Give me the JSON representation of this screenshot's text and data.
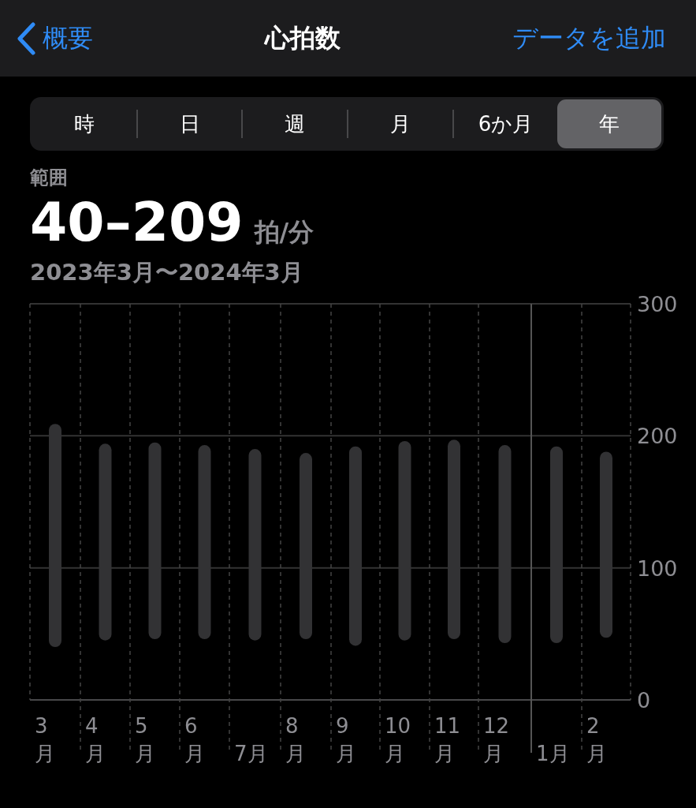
{
  "header": {
    "back_label": "概要",
    "title": "心拍数",
    "action": "データを追加"
  },
  "segments": [
    {
      "label": "時",
      "selected": false
    },
    {
      "label": "日",
      "selected": false
    },
    {
      "label": "週",
      "selected": false
    },
    {
      "label": "月",
      "selected": false
    },
    {
      "label": "6か月",
      "selected": false
    },
    {
      "label": "年",
      "selected": true
    }
  ],
  "summary": {
    "label": "範囲",
    "value": "40–209",
    "unit": "拍/分",
    "period": "2023年3月〜2024年3月"
  },
  "chart": {
    "month_labels": [
      {
        "stacked": true
      },
      {
        "stacked": true
      },
      {
        "stacked": true
      },
      {
        "stacked": true
      },
      {
        "stacked": false
      },
      {
        "stacked": true
      },
      {
        "stacked": true
      },
      {
        "stacked": true
      },
      {
        "stacked": true
      },
      {
        "stacked": true
      },
      {
        "stacked": false
      },
      {
        "stacked": true
      }
    ],
    "chart_data": {
      "type": "candlestick",
      "categories": [
        "3月",
        "4月",
        "5月",
        "6月",
        "7月",
        "8月",
        "9月",
        "10月",
        "11月",
        "12月",
        "1月",
        "2月"
      ],
      "ohlc": [
        [
          40,
          209,
          40,
          209
        ],
        [
          45,
          194,
          45,
          194
        ],
        [
          46,
          195,
          46,
          195
        ],
        [
          46,
          193,
          46,
          193
        ],
        [
          45,
          190,
          45,
          190
        ],
        [
          46,
          187,
          46,
          187
        ],
        [
          41,
          192,
          41,
          192
        ],
        [
          45,
          196,
          45,
          196
        ],
        [
          46,
          197,
          46,
          197
        ],
        [
          43,
          193,
          43,
          193
        ],
        [
          43,
          192,
          43,
          192
        ],
        [
          47,
          188,
          47,
          188
        ]
      ],
      "ref_lines": [
        {
          "axis": "x",
          "value": "1月"
        }
      ],
      "ylim": [
        0,
        300
      ],
      "yticks": [
        0,
        100,
        200,
        300
      ]
    }
  }
}
